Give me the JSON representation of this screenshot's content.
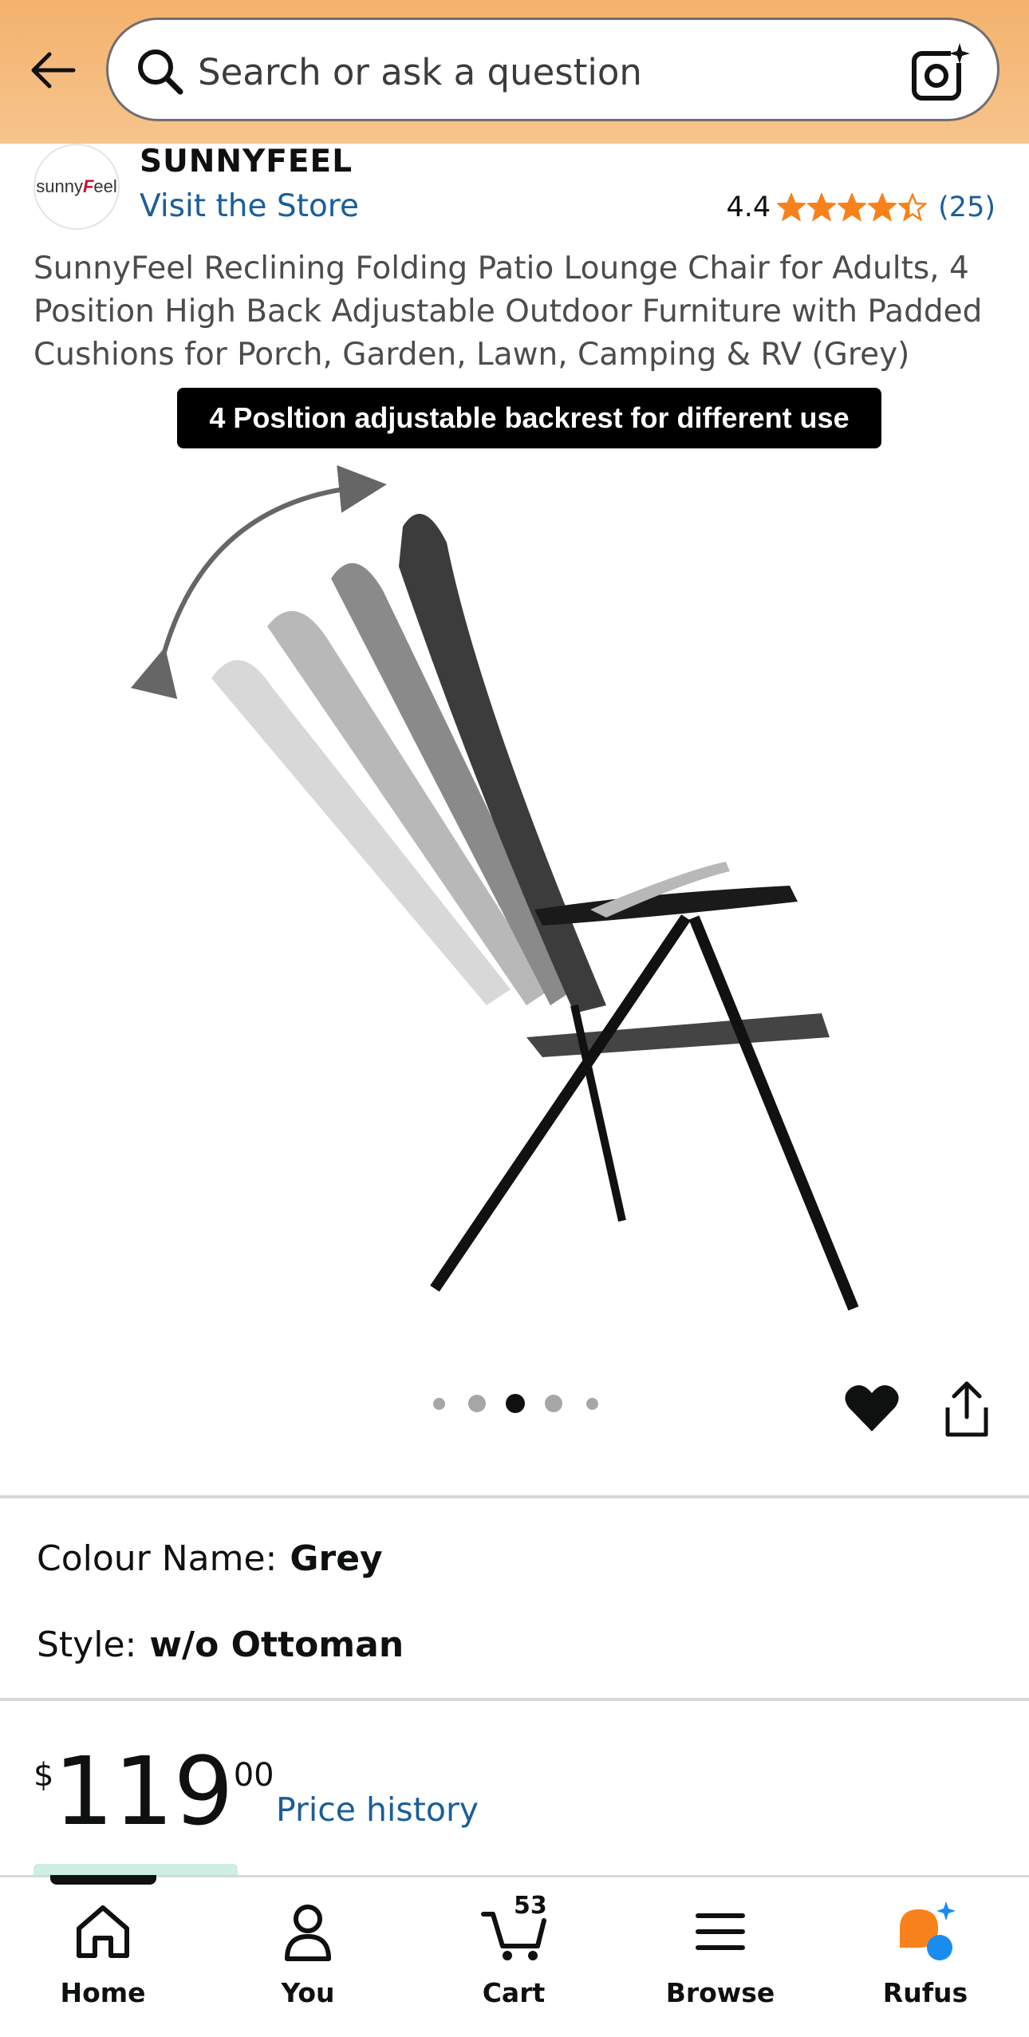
{
  "search": {
    "placeholder": "Search or ask a question"
  },
  "brand": {
    "logo_text_prefix": "sunny",
    "logo_text_f": "F",
    "logo_text_suffix": "eel",
    "name": "SUNNYFEEL",
    "visit_store": "Visit the Store"
  },
  "rating": {
    "value": "4.4",
    "stars": 4.4,
    "count": "(25)"
  },
  "product": {
    "title": "SunnyFeel Reclining Folding Patio Lounge Chair for Adults, 4 Position High Back Adjustable Outdoor Furniture with Padded Cushions for Porch, Garden, Lawn, Camping & RV (Grey)",
    "image_caption": "4 Posltion adjustable backrest for different use",
    "image_count": 5,
    "active_image_index": 3
  },
  "options": {
    "colour_label": "Colour Name:",
    "colour_value": "Grey",
    "style_label": "Style:",
    "style_value": "w/o Ottoman"
  },
  "price": {
    "currency": "$",
    "whole": "119",
    "fraction": "00",
    "history_link": "Price history"
  },
  "nav": {
    "items": [
      {
        "label": "Home",
        "icon": "home-icon",
        "active": true
      },
      {
        "label": "You",
        "icon": "person-icon",
        "active": false
      },
      {
        "label": "Cart",
        "icon": "cart-icon",
        "active": false
      },
      {
        "label": "Browse",
        "icon": "menu-icon",
        "active": false
      },
      {
        "label": "Rufus",
        "icon": "rufus-icon",
        "active": false
      }
    ],
    "cart_count": "53"
  },
  "colors": {
    "header_gradient_top": "#f4b26d",
    "link": "#1a5e9a",
    "star": "#f7811a",
    "rufus_orange": "#f7811a",
    "rufus_blue": "#1a8cf0"
  }
}
